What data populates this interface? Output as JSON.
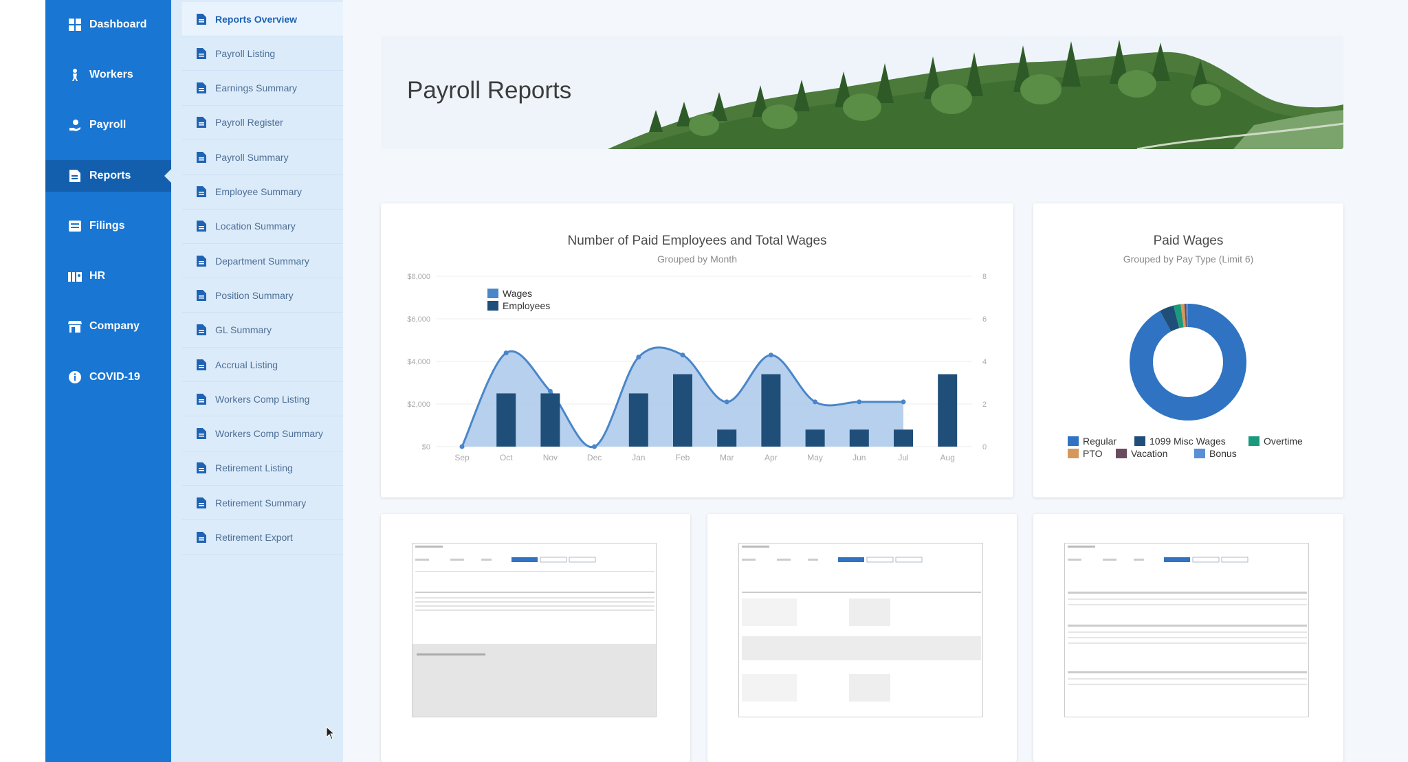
{
  "nav": {
    "items": [
      {
        "label": "Dashboard",
        "icon": "grid-icon"
      },
      {
        "label": "Workers",
        "icon": "person-walk-icon"
      },
      {
        "label": "Payroll",
        "icon": "money-hand-icon"
      },
      {
        "label": "Reports",
        "icon": "report-icon",
        "active": true
      },
      {
        "label": "Filings",
        "icon": "filings-icon"
      },
      {
        "label": "HR",
        "icon": "hr-icon"
      },
      {
        "label": "Company",
        "icon": "store-icon"
      },
      {
        "label": "COVID-19",
        "icon": "info-icon"
      }
    ]
  },
  "reports_menu": {
    "items": [
      {
        "label": "Reports Overview",
        "active": true
      },
      {
        "label": "Payroll Listing"
      },
      {
        "label": "Earnings Summary"
      },
      {
        "label": "Payroll Register"
      },
      {
        "label": "Payroll Summary"
      },
      {
        "label": "Employee Summary"
      },
      {
        "label": "Location Summary"
      },
      {
        "label": "Department Summary"
      },
      {
        "label": "Position Summary"
      },
      {
        "label": "GL Summary"
      },
      {
        "label": "Accrual Listing"
      },
      {
        "label": "Workers Comp Listing"
      },
      {
        "label": "Workers Comp Summary"
      },
      {
        "label": "Retirement Listing"
      },
      {
        "label": "Retirement Summary"
      },
      {
        "label": "Retirement Export"
      }
    ]
  },
  "page": {
    "title": "Payroll Reports"
  },
  "colors": {
    "nav_bg": "#1976d2",
    "nav_active": "#135fae",
    "submenu_bg": "#dcebfa",
    "wages": "#4a86c8",
    "employees": "#1f4e79",
    "area": "#a9c8ea",
    "regular": "#2f73c2",
    "misc1099": "#1f4e79",
    "overtime": "#1a9a7d",
    "pto": "#d6985a",
    "vacation": "#6b4c5e",
    "bonus": "#5a8ed6"
  },
  "chart_data": [
    {
      "type": "bar",
      "title": "Number of Paid Employees and Total Wages",
      "subtitle": "Grouped by Month",
      "categories": [
        "Sep",
        "Oct",
        "Nov",
        "Dec",
        "Jan",
        "Feb",
        "Mar",
        "Apr",
        "May",
        "Jun",
        "Jul",
        "Aug"
      ],
      "y_left_ticks": [
        "$0",
        "$2,000",
        "$4,000",
        "$6,000",
        "$8,000"
      ],
      "y_left_range": [
        0,
        8000
      ],
      "y_right_ticks": [
        "0",
        "2",
        "4",
        "6",
        "8"
      ],
      "y_right_range": [
        0,
        8
      ],
      "legend_position": "top-left",
      "series": [
        {
          "name": "Wages",
          "kind": "area",
          "values": [
            0,
            4400,
            2600,
            0,
            4200,
            4300,
            2100,
            4300,
            2100,
            2100,
            2100,
            null
          ]
        },
        {
          "name": "Employees",
          "kind": "bar",
          "values": [
            null,
            2.5,
            2.5,
            null,
            2.5,
            3.4,
            0.8,
            3.4,
            0.8,
            0.8,
            0.8,
            3.4
          ]
        }
      ]
    },
    {
      "type": "pie",
      "title": "Paid Wages",
      "subtitle": "Grouped by Pay Type (Limit 6)",
      "legend_position": "bottom",
      "labels": [
        "Regular",
        "1099 Misc Wages",
        "Overtime",
        "PTO",
        "Vacation",
        "Bonus"
      ],
      "values": [
        92,
        4,
        2,
        1,
        0.5,
        0.5
      ]
    }
  ]
}
